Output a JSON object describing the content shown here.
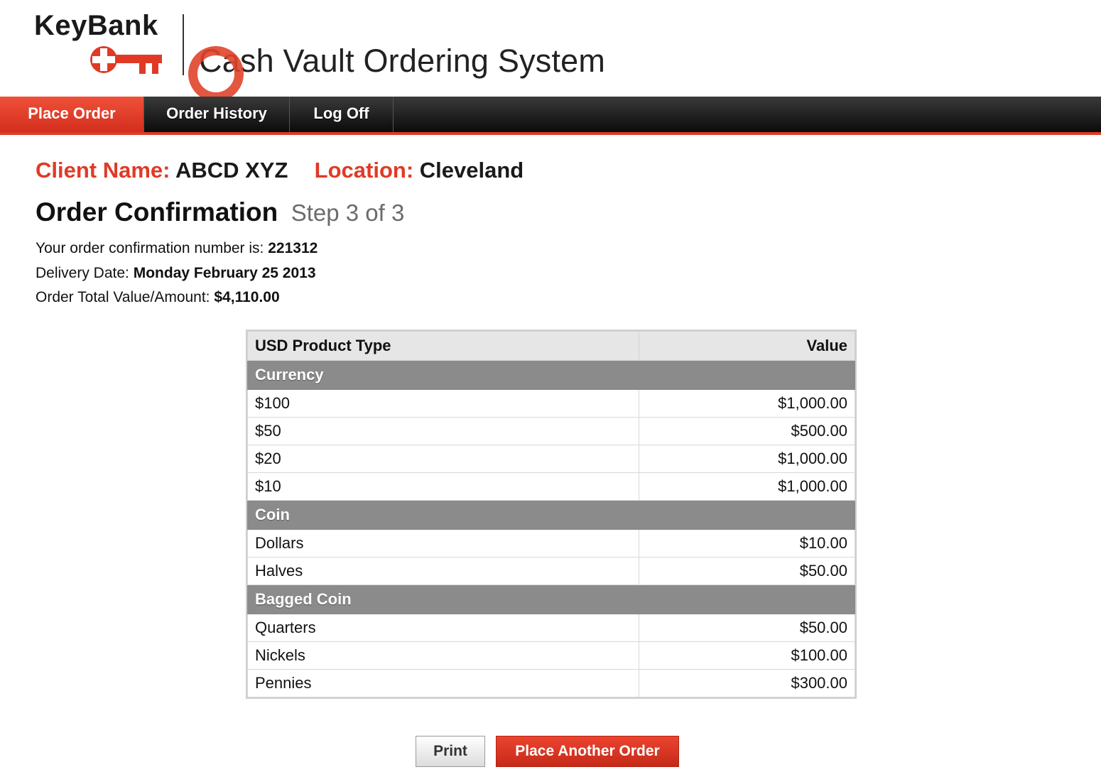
{
  "brand": {
    "logo_text": "KeyBank",
    "app_title": "Cash Vault Ordering System",
    "accent_color": "#e03a26"
  },
  "nav": {
    "items": [
      {
        "label": "Place Order"
      },
      {
        "label": "Order History"
      },
      {
        "label": "Log Off"
      }
    ]
  },
  "client": {
    "name_label": "Client Name:",
    "name": "ABCD XYZ",
    "location_label": "Location:",
    "location": "Cleveland"
  },
  "page": {
    "title": "Order Confirmation",
    "step": "Step 3 of 3"
  },
  "details": {
    "confirmation_label": "Your order confirmation number is:",
    "confirmation_number": "221312",
    "delivery_label": "Delivery Date:",
    "delivery_date": "Monday February 25 2013",
    "total_label": "Order Total Value/Amount:",
    "total": "$4,110.00"
  },
  "table": {
    "headers": {
      "product": "USD Product Type",
      "value": "Value"
    },
    "sections": [
      {
        "category": "Currency",
        "rows": [
          {
            "product": "$100",
            "value": "$1,000.00"
          },
          {
            "product": "$50",
            "value": "$500.00"
          },
          {
            "product": "$20",
            "value": "$1,000.00"
          },
          {
            "product": "$10",
            "value": "$1,000.00"
          }
        ]
      },
      {
        "category": "Coin",
        "rows": [
          {
            "product": "Dollars",
            "value": "$10.00"
          },
          {
            "product": "Halves",
            "value": "$50.00"
          }
        ]
      },
      {
        "category": "Bagged Coin",
        "rows": [
          {
            "product": "Quarters",
            "value": "$50.00"
          },
          {
            "product": "Nickels",
            "value": "$100.00"
          },
          {
            "product": "Pennies",
            "value": "$300.00"
          }
        ]
      }
    ]
  },
  "buttons": {
    "print": "Print",
    "place_another": "Place Another Order"
  }
}
